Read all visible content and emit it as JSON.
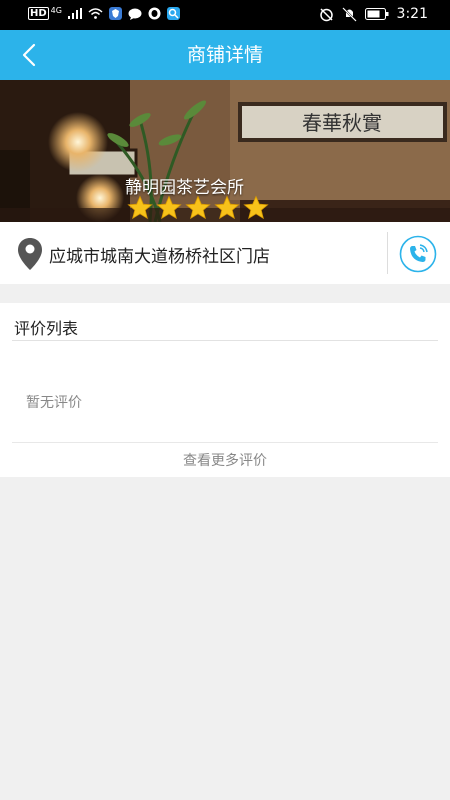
{
  "status_bar": {
    "network_label": "HD",
    "network_gen": "4G",
    "time": "3:21"
  },
  "nav": {
    "title": "商铺详情",
    "back_icon": "chevron-left-icon"
  },
  "shop": {
    "name": "静明园茶艺会所",
    "rating_stars": 5,
    "rating_max": 5,
    "banner_calligraphy": "春華秋實",
    "address": "应城市城南大道杨桥社区门店"
  },
  "reviews": {
    "section_title": "评价列表",
    "empty_text": "暂无评价",
    "more_label": "查看更多评价"
  },
  "colors": {
    "accent": "#2cb3ea",
    "star": "#f7c21a",
    "background": "#f0f0f0"
  }
}
